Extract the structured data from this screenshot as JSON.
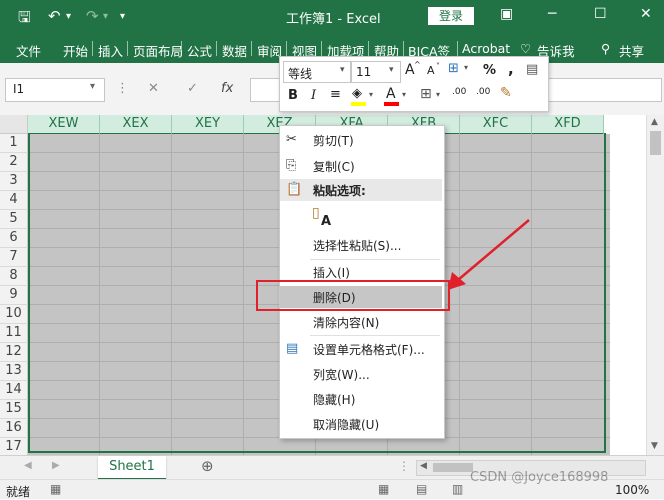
{
  "title_bar": {
    "document_title": "工作簿1  -  Excel",
    "login_label": "登录"
  },
  "menu": {
    "items": [
      "文件",
      "开始",
      "插入",
      "页面布局",
      "公式",
      "数据",
      "审阅",
      "视图",
      "加载项",
      "帮助",
      "BJCA签",
      "Acrobat",
      "告诉我",
      "共享"
    ]
  },
  "formula_bar": {
    "name_box": "I1",
    "fx": "fx"
  },
  "grid": {
    "columns": [
      "XEW",
      "XEX",
      "XEY",
      "XEZ",
      "XFA",
      "XFB",
      "XFC",
      "XFD"
    ],
    "rows": [
      "1",
      "2",
      "3",
      "4",
      "5",
      "6",
      "7",
      "8",
      "9",
      "10",
      "11",
      "12",
      "13",
      "14",
      "15",
      "16",
      "17"
    ]
  },
  "mini_toolbar": {
    "font_name": "等线",
    "font_size": "11",
    "grow": "A",
    "shrink": "A",
    "percent": "%",
    "comma": ",",
    "bold": "B",
    "italic": "I",
    "font_color_glyph": "A",
    "dec_inc": ".00",
    "dec_dec": ".00"
  },
  "context_menu": {
    "items": [
      {
        "label": "剪切(T)",
        "icon": "scissors-icon"
      },
      {
        "label": "复制(C)",
        "icon": "copy-icon"
      },
      {
        "label": "粘贴选项:",
        "icon": "paste-icon"
      },
      {
        "label": "A",
        "icon": "paste-values-icon"
      },
      {
        "label": "选择性粘贴(S)...",
        "icon": ""
      },
      {
        "label": "插入(I)",
        "icon": ""
      },
      {
        "label": "删除(D)",
        "icon": ""
      },
      {
        "label": "清除内容(N)",
        "icon": ""
      },
      {
        "label": "设置单元格格式(F)...",
        "icon": "format-cells-icon"
      },
      {
        "label": "列宽(W)...",
        "icon": ""
      },
      {
        "label": "隐藏(H)",
        "icon": ""
      },
      {
        "label": "取消隐藏(U)",
        "icon": ""
      }
    ]
  },
  "sheets": {
    "active": "Sheet1"
  },
  "status_bar": {
    "status": "就绪",
    "zoom": "100%"
  },
  "watermark": "CSDN @Joyce168998",
  "colors": {
    "excel_green": "#217346",
    "highlight": "#c6c6c6",
    "annotation_red": "#e0202a"
  }
}
